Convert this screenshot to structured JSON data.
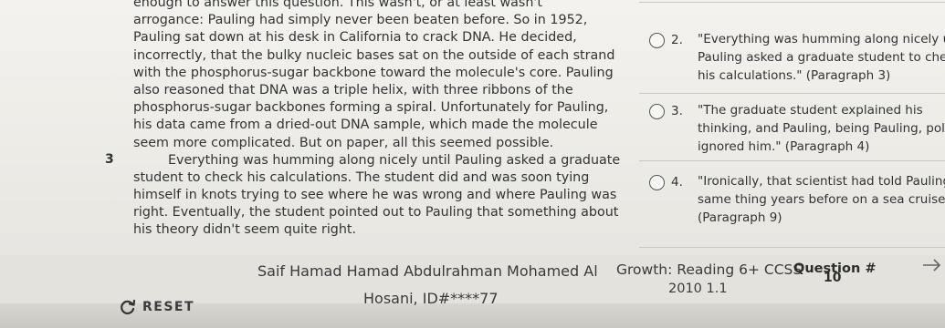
{
  "passage": {
    "lines": [
      "enough to answer this question. This wasn't, or at least wasn't",
      "arrogance: Pauling had simply never been beaten before. So in 1952,",
      "Pauling sat down at his desk in California to crack DNA. He decided,",
      "incorrectly, that the bulky nucleic bases sat on the outside of each strand",
      "with the phosphorus-sugar backbone toward the molecule's core. Pauling",
      "also reasoned that DNA was a triple helix, with three ribbons of the",
      "phosphorus-sugar backbones forming a spiral. Unfortunately for Pauling,",
      "his data came from a dried-out DNA sample, which made the molecule",
      "seem more complicated. But on paper, all this seemed possible."
    ],
    "paragraph_number": "3",
    "paragraph3_lines": [
      "Everything was humming along nicely until Pauling asked a graduate",
      "student to check his calculations. The student did and was soon tying",
      "himself in knots trying to see where he was wrong and where Pauling was",
      "right. Eventually, the student pointed out to Pauling that something about",
      "his theory didn't seem quite right."
    ]
  },
  "options": [
    {
      "number": "2.",
      "lines": [
        "\"Everything was humming along nicely unt",
        "Pauling asked a graduate student to check",
        "his calculations.\" (Paragraph 3)"
      ]
    },
    {
      "number": "3.",
      "lines": [
        "\"The graduate student explained his",
        "thinking, and Pauling, being Pauling, polite",
        "ignored him.\" (Paragraph 4)"
      ]
    },
    {
      "number": "4.",
      "lines": [
        "\"Ironically, that scientist had told Pauling t",
        "same thing years before on a sea cruise.\"",
        "(Paragraph 9)"
      ]
    }
  ],
  "footer": {
    "student_name": "Saif Hamad Hamad Abdulrahman Mohamed Al",
    "student_id": "Hosani, ID#****77",
    "growth": "Growth: Reading 6+ CCSS",
    "code": "2010 1.1",
    "question_label": "Question #",
    "question_number": "10",
    "reset_label": "RESET"
  },
  "icons": {
    "reset": "refresh-icon",
    "next": "arrow-right-icon"
  }
}
